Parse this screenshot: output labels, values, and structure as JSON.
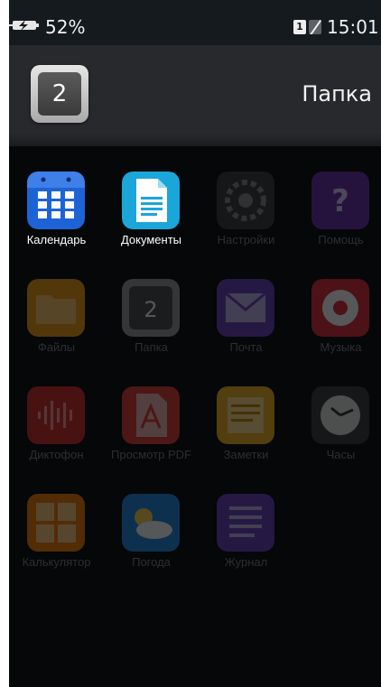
{
  "status_bar": {
    "battery_percent": "52%",
    "sim1_label": "1",
    "time": "15:01",
    "battery_icon": "battery-charging-icon",
    "sim_icons": [
      "sim1-icon",
      "sim2-no-signal-icon"
    ]
  },
  "folder": {
    "title": "Папка",
    "icon_number": "2"
  },
  "apps": [
    {
      "label": "Календарь",
      "icon": "calendar-icon",
      "color": "#1e63d6",
      "active": true
    },
    {
      "label": "Документы",
      "icon": "documents-icon",
      "color": "#1aa6d9",
      "active": true
    },
    {
      "label": "Настройки",
      "icon": "settings-icon",
      "color": "#5a5a5a",
      "active": false
    },
    {
      "label": "Помощь",
      "icon": "help-icon",
      "color": "#6a2fb0",
      "active": false
    },
    {
      "label": "Файлы",
      "icon": "files-icon",
      "color": "#f39c12",
      "active": false
    },
    {
      "label": "Папка",
      "icon": "folder-icon",
      "color": "#555555",
      "active": false
    },
    {
      "label": "Почта",
      "icon": "mail-icon",
      "color": "#6a3fc2",
      "active": false
    },
    {
      "label": "Музыка",
      "icon": "music-icon",
      "color": "#e02a3a",
      "active": false
    },
    {
      "label": "Диктофон",
      "icon": "voice-recorder-icon",
      "color": "#d62a2a",
      "active": false
    },
    {
      "label": "Просмотр PDF",
      "icon": "pdf-viewer-icon",
      "color": "#e53935",
      "active": false
    },
    {
      "label": "Заметки",
      "icon": "notes-icon",
      "color": "#f3b21b",
      "active": false
    },
    {
      "label": "Часы",
      "icon": "clock-icon",
      "color": "#888888",
      "active": false
    },
    {
      "label": "Калькулятор",
      "icon": "calculator-icon",
      "color": "#f57c00",
      "active": false
    },
    {
      "label": "Погода",
      "icon": "weather-icon",
      "color": "#1e88e5",
      "active": false
    },
    {
      "label": "Журнал",
      "icon": "journal-icon",
      "color": "#6a3fc2",
      "active": false
    }
  ]
}
